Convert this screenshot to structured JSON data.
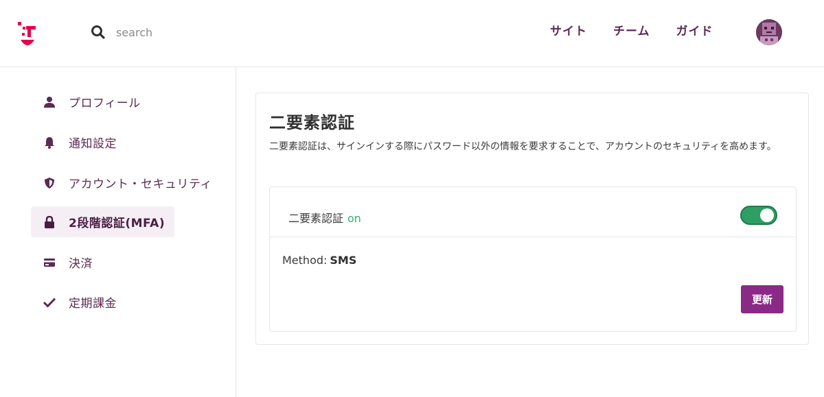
{
  "header": {
    "search_placeholder": "search",
    "nav": [
      "サイト",
      "チーム",
      "ガイド"
    ]
  },
  "sidebar": {
    "items": [
      {
        "label": "プロフィール",
        "icon": "person-icon"
      },
      {
        "label": "通知設定",
        "icon": "bell-icon"
      },
      {
        "label": "アカウント・セキュリティ",
        "icon": "shield-icon"
      },
      {
        "label": "2段階認証(MFA)",
        "icon": "lock-icon",
        "active": true
      },
      {
        "label": "決済",
        "icon": "credit-card-icon"
      },
      {
        "label": "定期課金",
        "icon": "check-icon"
      }
    ]
  },
  "main": {
    "title": "二要素認証",
    "description": "二要素認証は、サインインする際にパスワード以外の情報を要求することで、アカウントのセキュリティを高めます。",
    "mfa_label": "二要素認証",
    "mfa_state": "on",
    "method_label": "Method:",
    "method_value": "SMS",
    "update_button": "更新"
  },
  "colors": {
    "brand": "#e6004c",
    "accent": "#8a2a86",
    "nav_text": "#5c2a52",
    "on_green": "#2bb673",
    "toggle_bg": "#2e9e64"
  }
}
